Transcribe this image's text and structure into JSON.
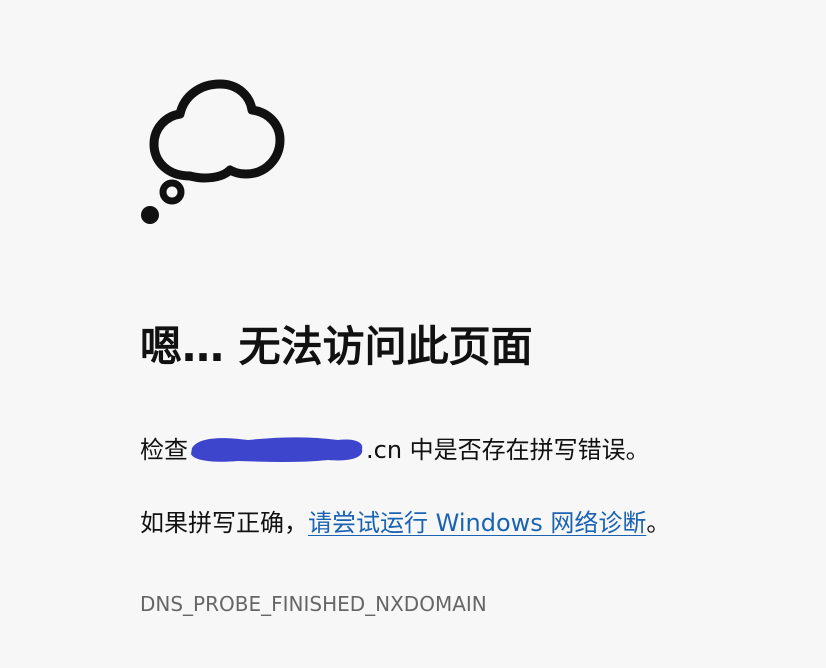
{
  "error": {
    "icon": "thought-bubble-icon",
    "title": "嗯… 无法访问此页面",
    "check_prefix": "检查",
    "check_domain_suffix": ".cn",
    "check_suffix": " 中是否存在拼写错误。",
    "suggest_prefix": "如果拼写正确，",
    "suggest_link": "请尝试运行 Windows 网络诊断",
    "suggest_suffix": "。",
    "code": "DNS_PROBE_FINISHED_NXDOMAIN"
  },
  "colors": {
    "background": "#f7f7f7",
    "link": "#1a63b3",
    "redaction": "#3d45cc",
    "code_text": "#666666"
  }
}
